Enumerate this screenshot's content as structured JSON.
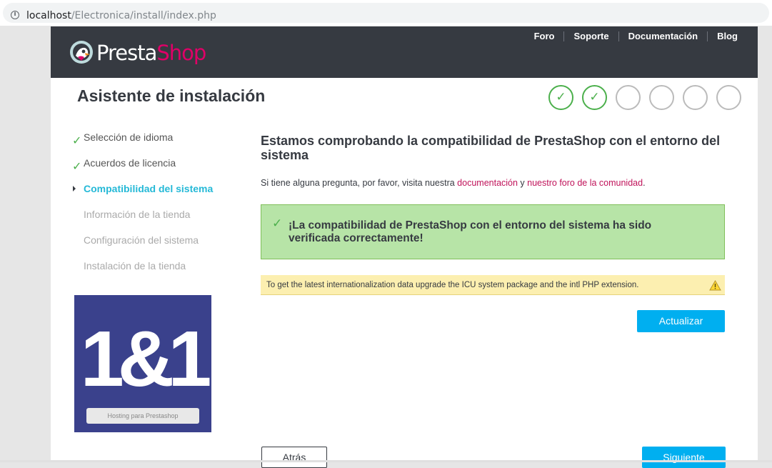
{
  "browser": {
    "url_host": "localhost",
    "url_path": "/Electronica/install/index.php"
  },
  "header": {
    "logo_text_a": "Presta",
    "logo_text_b": "Shop",
    "nav": [
      {
        "label": "Foro"
      },
      {
        "label": "Soporte"
      },
      {
        "label": "Documentación"
      },
      {
        "label": "Blog"
      }
    ]
  },
  "wizard": {
    "title": "Asistente de instalación",
    "steps": [
      {
        "state": "done",
        "mark": "✓"
      },
      {
        "state": "done",
        "mark": "✓"
      },
      {
        "state": "pending",
        "mark": ""
      },
      {
        "state": "pending",
        "mark": ""
      },
      {
        "state": "pending",
        "mark": ""
      },
      {
        "state": "pending",
        "mark": ""
      }
    ]
  },
  "sidebar": {
    "items": [
      {
        "label": "Selección de idioma",
        "state": "done"
      },
      {
        "label": "Acuerdos de licencia",
        "state": "done"
      },
      {
        "label": "Compatibilidad del sistema",
        "state": "active"
      },
      {
        "label": "Información de la tienda",
        "state": "pending"
      },
      {
        "label": "Configuración del sistema",
        "state": "pending"
      },
      {
        "label": "Instalación de la tienda",
        "state": "pending"
      }
    ],
    "banner_logo": "1&1",
    "banner_caption": "Hosting para Prestashop"
  },
  "main": {
    "title": "Estamos comprobando la compatibilidad de PrestaShop con el entorno del sistema",
    "help_prefix": "Si tiene alguna pregunta, por favor, visita nuestra ",
    "help_link1": "documentación",
    "help_middle": " y ",
    "help_link2": "nuestro foro de la comunidad",
    "help_suffix": ".",
    "success_message": "¡La compatibilidad de PrestaShop con el entorno del sistema ha sido verificada correctamente!",
    "warning_message": "To get the latest internationalization data upgrade the ICU system package and the intl PHP extension.",
    "update_button": "Actualizar",
    "back_button": "Atrás",
    "next_button": "Siguiente"
  },
  "colors": {
    "header_bg": "#363a41",
    "brand_pink": "#df0067",
    "accent_blue": "#00aff0",
    "active_step": "#25b9d7",
    "success_bg": "#b7e4a7",
    "warning_bg": "#fcefb0"
  }
}
